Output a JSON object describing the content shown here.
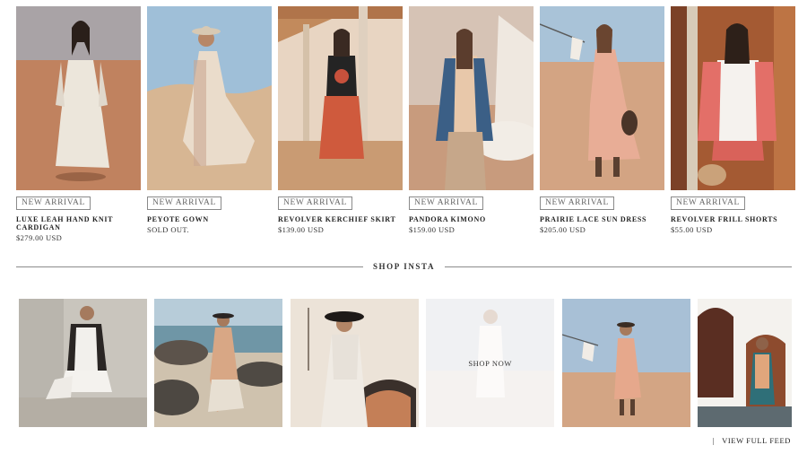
{
  "products": [
    {
      "badge": "NEW ARRIVAL",
      "name": "LUXE LEAH HAND KNIT CARDIGAN",
      "price": "$279.00 USD"
    },
    {
      "badge": "NEW ARRIVAL",
      "name": "PEYOTE GOWN",
      "price": "SOLD OUT."
    },
    {
      "badge": "NEW ARRIVAL",
      "name": "REVOLVER KERCHIEF SKIRT",
      "price": "$139.00 USD"
    },
    {
      "badge": "NEW ARRIVAL",
      "name": "PANDORA KIMONO",
      "price": "$159.00 USD"
    },
    {
      "badge": "NEW ARRIVAL",
      "name": "PRAIRIE LACE SUN DRESS",
      "price": "$205.00 USD"
    },
    {
      "badge": "NEW ARRIVAL",
      "name": "REVOLVER FRILL SHORTS",
      "price": "$55.00 USD"
    }
  ],
  "insta": {
    "title": "SHOP INSTA",
    "shop_now": "SHOP NOW",
    "view_feed_separator": "|",
    "view_feed": "VIEW FULL FEED"
  }
}
